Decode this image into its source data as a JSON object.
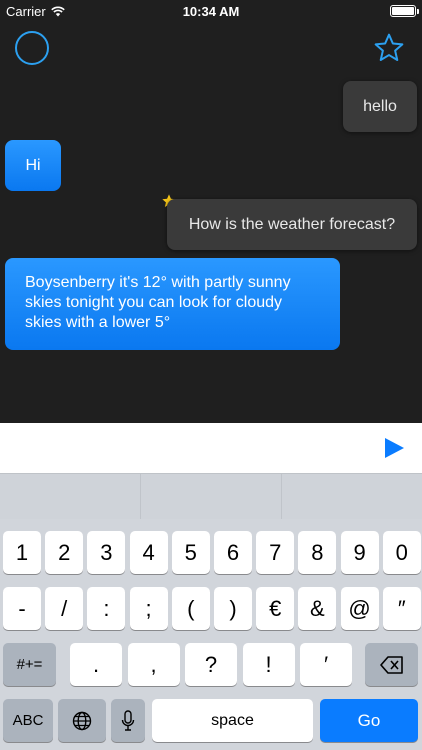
{
  "status_bar": {
    "carrier": "Carrier",
    "time": "10:34 AM"
  },
  "icons": {
    "assistant": "assistant-ring-icon",
    "favorites": "star-outline-icon",
    "send": "send-arrow-icon"
  },
  "messages": [
    {
      "sender": "user",
      "text": "hello"
    },
    {
      "sender": "bot",
      "text": "Hi"
    },
    {
      "sender": "user",
      "text": "How is the weather forecast?",
      "starred": true
    },
    {
      "sender": "bot",
      "text": "Boysenberry it's 12° with partly sunny skies tonight you can look for cloudy skies with a lower 5°"
    }
  ],
  "input": {
    "value": "",
    "placeholder": ""
  },
  "keyboard": {
    "row1": [
      "1",
      "2",
      "3",
      "4",
      "5",
      "6",
      "7",
      "8",
      "9",
      "0"
    ],
    "row2": [
      "-",
      "/",
      ":",
      ";",
      "(",
      ")",
      "€",
      "&",
      "@",
      "″"
    ],
    "row3_left": "#+=",
    "row3": [
      ".",
      ",",
      "?",
      "!",
      "′"
    ],
    "abc": "ABC",
    "space": "space",
    "go": "Go"
  },
  "colors": {
    "accent": "#2ca0f0",
    "bot_bubble": "#0a78f0",
    "user_bubble": "#3a3a3a",
    "star": "#f5c518"
  }
}
